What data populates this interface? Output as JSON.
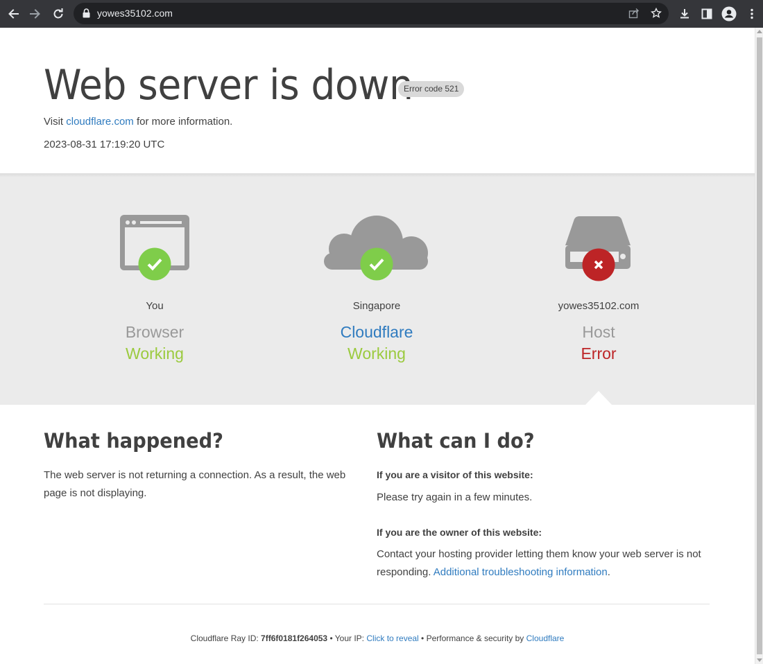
{
  "browser": {
    "url": "yowes35102.com",
    "icons": [
      "back-arrow-icon",
      "forward-arrow-icon",
      "reload-icon",
      "lock-icon",
      "share-icon",
      "star-icon",
      "download-icon",
      "side-panel-icon",
      "profile-icon",
      "kebab-menu-icon"
    ]
  },
  "page": {
    "headline": "Web server is down",
    "error_badge": "Error code 521",
    "visit_prefix": "Visit ",
    "visit_link": "cloudflare.com",
    "visit_suffix": " for more information.",
    "timestamp": "2023-08-31 17:19:20 UTC"
  },
  "status": [
    {
      "location": "You",
      "role": "Browser",
      "state": "Working",
      "icon": "browser-icon",
      "badge": "check-icon"
    },
    {
      "location": "Singapore",
      "role": "Cloudflare",
      "state": "Working",
      "icon": "cloud-icon",
      "badge": "check-icon"
    },
    {
      "location": "yowes35102.com",
      "role": "Host",
      "state": "Error",
      "icon": "server-icon",
      "badge": "x-icon"
    }
  ],
  "what_happened": {
    "title": "What happened?",
    "text": "The web server is not returning a connection. As a result, the web page is not displaying."
  },
  "what_can_i_do": {
    "title": "What can I do?",
    "visitor_heading": "If you are a visitor of this website:",
    "visitor_text": "Please try again in a few minutes.",
    "owner_heading": "If you are the owner of this website:",
    "owner_text": "Contact your hosting provider letting them know your web server is not responding. ",
    "owner_link": "Additional troubleshooting information",
    "owner_end": "."
  },
  "footer": {
    "ray_label": "Cloudflare Ray ID: ",
    "ray_id": "7ff6f0181f264053",
    "sep1": " • Your IP: ",
    "reveal": "Click to reveal",
    "sep2": " • Performance & security by ",
    "brand": "Cloudflare"
  },
  "colors": {
    "working": "#9bca3e",
    "error": "#bd2426",
    "link": "#2f7bbf",
    "check_badge": "#7fcd4a",
    "icon_gray": "#999999"
  }
}
